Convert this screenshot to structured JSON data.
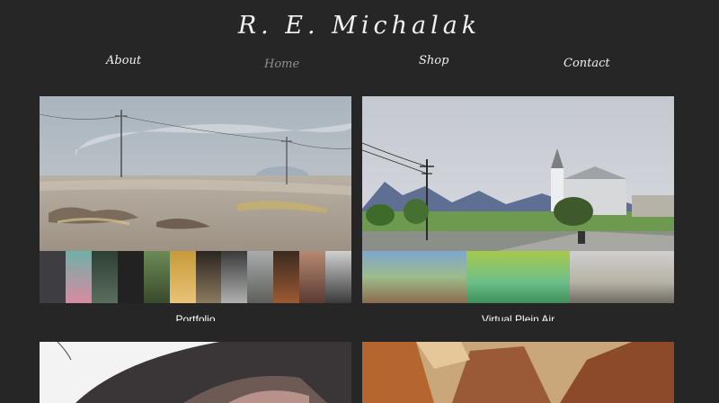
{
  "site": {
    "title": "R. E. Michalak"
  },
  "nav": {
    "items": [
      {
        "label": "About"
      },
      {
        "label": "Home",
        "active": true
      },
      {
        "label": "Shop"
      },
      {
        "label": "Contact"
      }
    ]
  },
  "gallery": {
    "cards": [
      {
        "caption": "Portfolio",
        "thumb_count": 12
      },
      {
        "caption": "Virtual Plein Air",
        "thumb_count": 3
      }
    ]
  },
  "colors": {
    "background": "#262626",
    "nav_active": "#8f8f8f",
    "text": "#ffffff"
  }
}
